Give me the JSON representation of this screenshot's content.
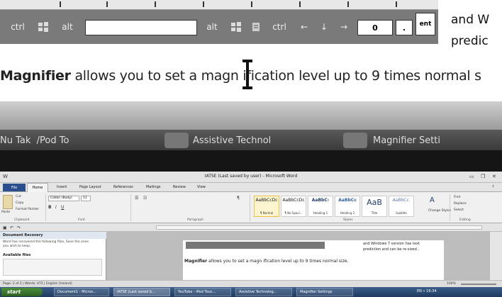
{
  "magnified": {
    "keys": {
      "ctrl_left": "ctrl",
      "alt_left": "alt",
      "alt_right": "alt",
      "ctrl_right": "ctrl",
      "num_key": "0",
      "dot_key": ".",
      "ent_key": "ent"
    },
    "line_bold": "Magnifier",
    "line_rest": " allows you to set a magn ification level up to 9 times normal s",
    "side_text_1": "and W",
    "side_text_2": "predic",
    "taskbar_items": [
      "Nu Tak  /Pod To",
      "Assistive Technol",
      "Magnifier Setti"
    ]
  },
  "word": {
    "title": "IATSE (Last saved by user) - Microsoft Word",
    "tabs": [
      "File",
      "Home",
      "Insert",
      "Page Layout",
      "References",
      "Mailings",
      "Review",
      "View"
    ],
    "clipboard": {
      "cut": "Cut",
      "copy": "Copy",
      "paste": "Paste",
      "format_painter": "Format Painter",
      "label": "Clipboard"
    },
    "font": {
      "name": "Calibri (Body)",
      "size": "11",
      "label": "Font"
    },
    "paragraph_label": "Paragraph",
    "styles": [
      {
        "preview": "AaBbCcDc",
        "name": "¶ Normal"
      },
      {
        "preview": "AaBbCcDc",
        "name": "¶ No Spaci..."
      },
      {
        "preview": "AaBbC‹",
        "name": "Heading 1"
      },
      {
        "preview": "AaBbCc",
        "name": "Heading 2"
      },
      {
        "preview": "AaB",
        "name": "Title"
      },
      {
        "preview": "AaBbCc.",
        "name": "Subtitle"
      }
    ],
    "styles_label": "Styles",
    "change_styles": "Change Styles",
    "editing": {
      "find": "Find",
      "replace": "Replace",
      "select": "Select",
      "label": "Editing"
    },
    "doc_recovery": {
      "heading": "Document Recovery",
      "message": "Word has recovered the following files.  Save the ones you wish to keep.",
      "available": "Available files"
    },
    "doc_small_1": "and Windows 7 version has text",
    "doc_small_2": "prediction and can be re-sized..",
    "doc_bold": "Magnifier",
    "doc_rest": " allows you to set a magn ification level up to 9 times normal size.",
    "status": "Page: 2 of 2  |  Words: 472  |  English (Ireland)",
    "zoom": "100%"
  },
  "taskbar": {
    "start": "start",
    "buttons": [
      "Document1 - Micros...",
      "IATSE (Last saved b...",
      "YouTube - iPod Touc...",
      "Assistive Technolog...",
      "Magnifier Settings"
    ],
    "tray": "EN  «  16:34"
  }
}
